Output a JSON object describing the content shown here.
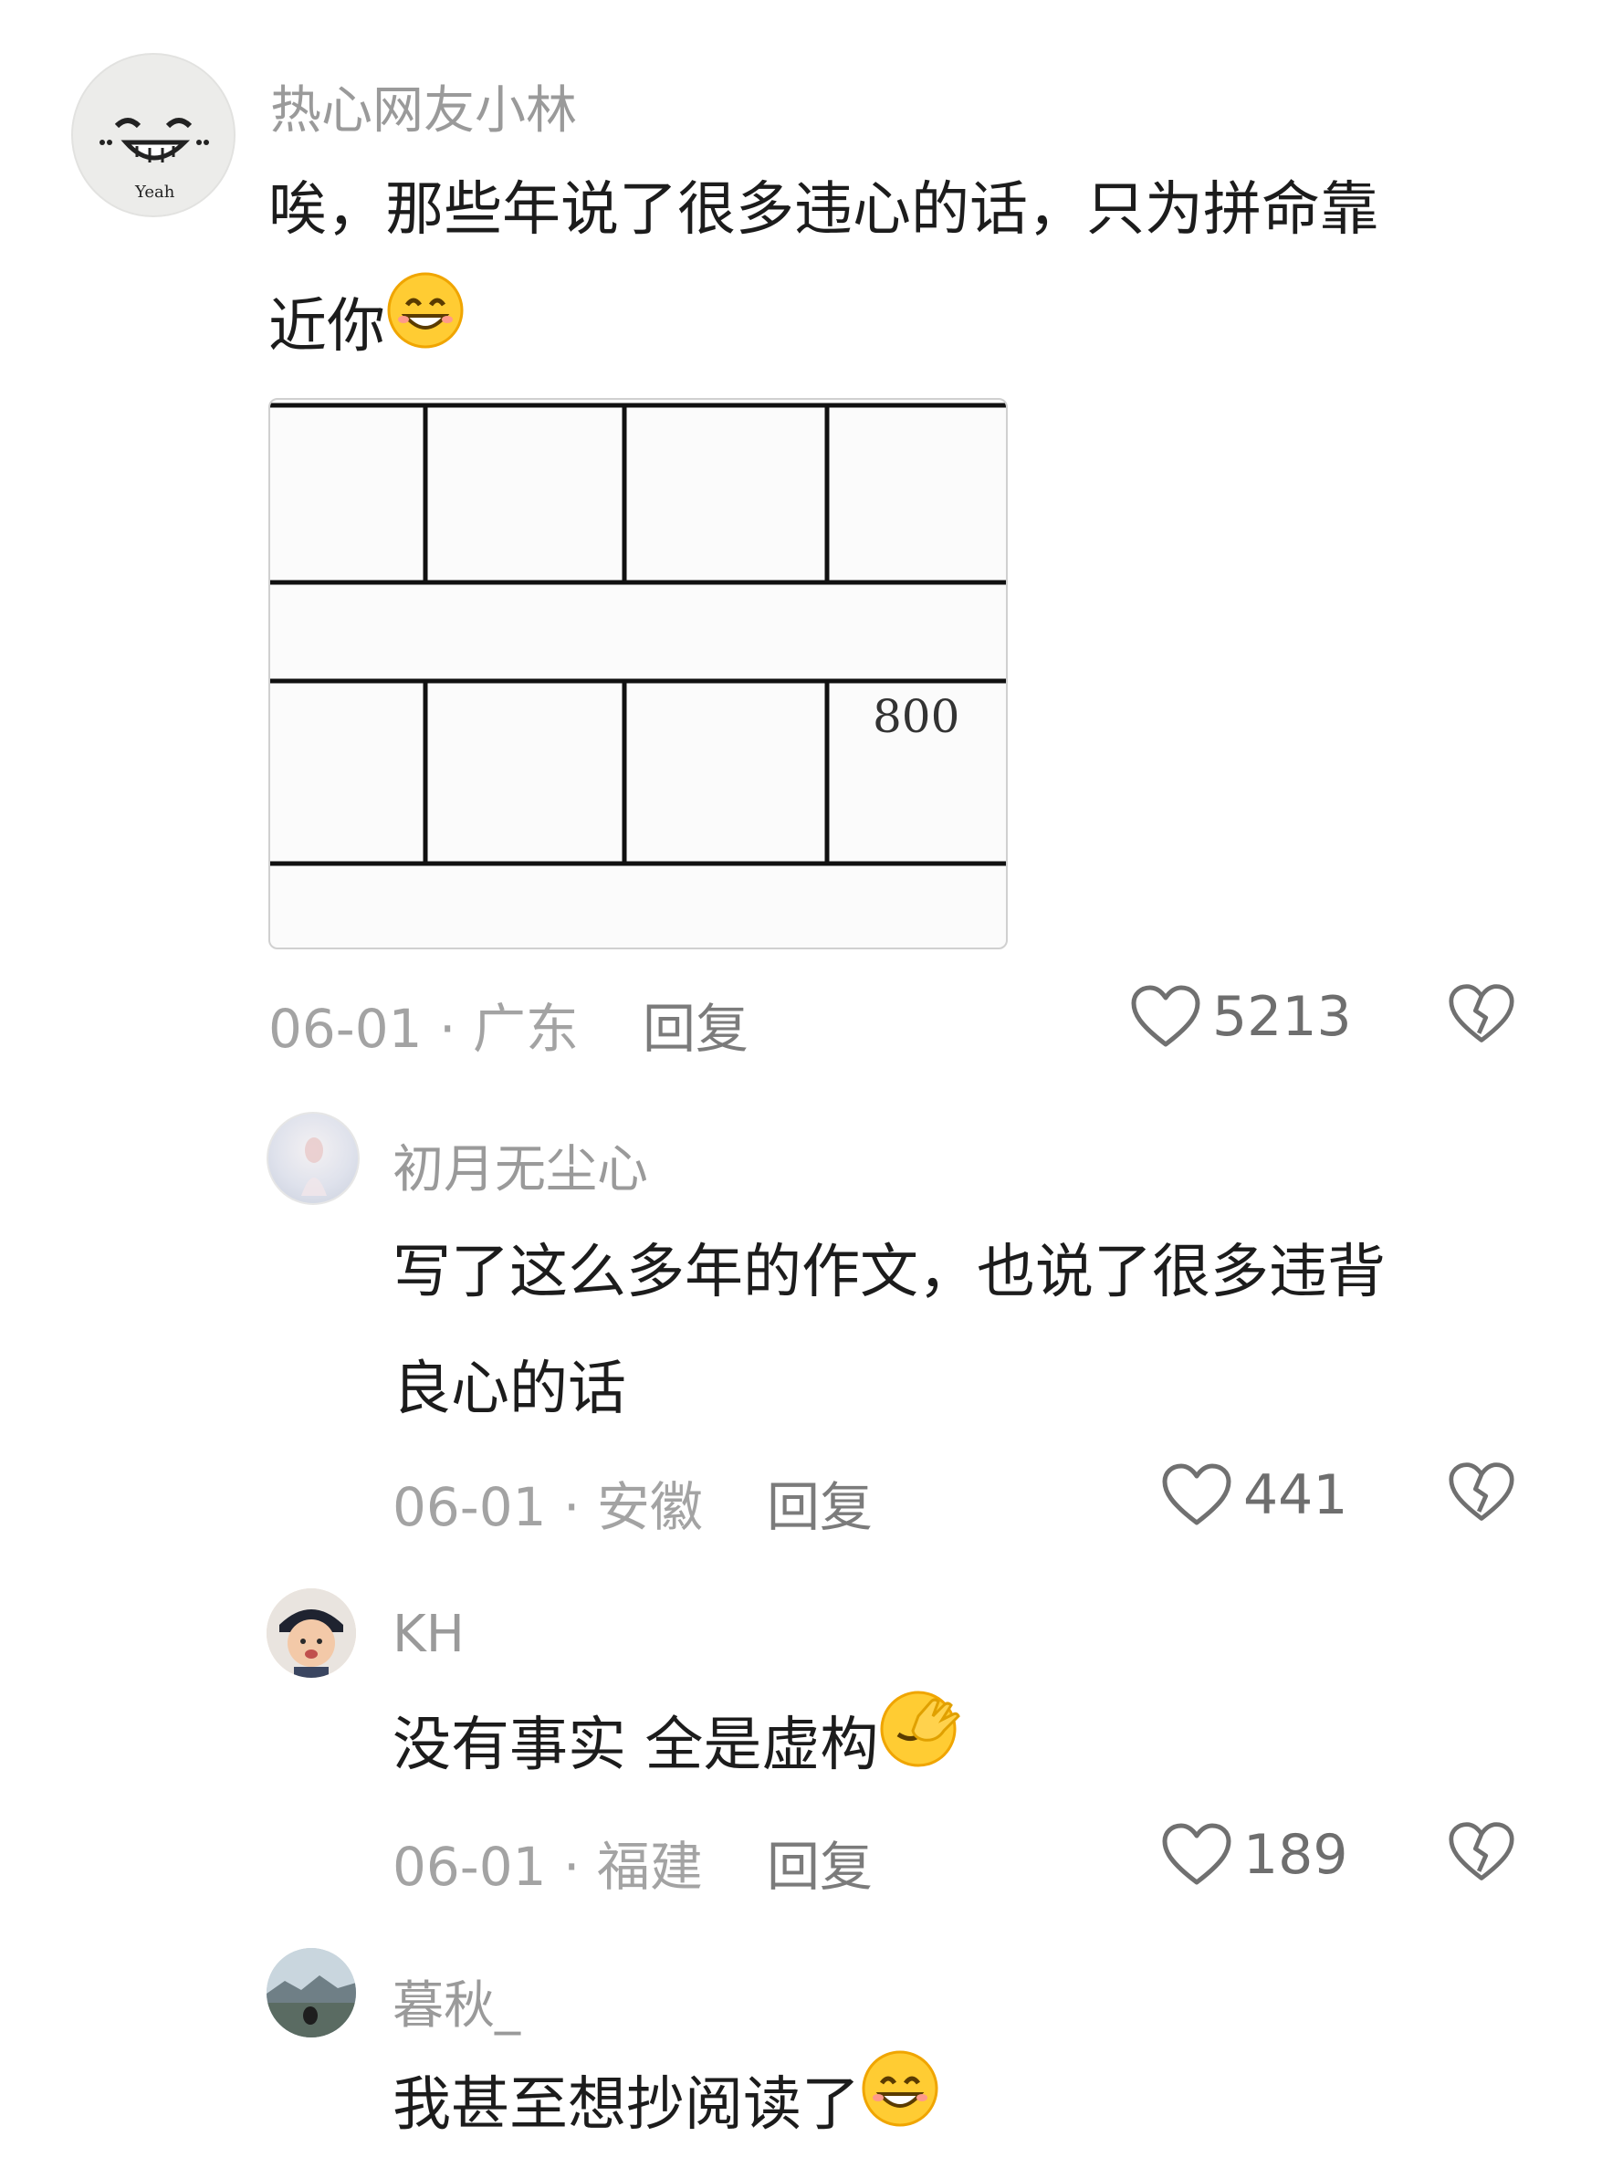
{
  "comments": [
    {
      "user": "热心网友小林",
      "avatar_text": "Yeah",
      "text": "唉，那些年说了很多违心的话，只为拼命靠近你",
      "text_line1": "唉，那些年说了很多违心的话，只为拼命靠",
      "text_line2": "近你",
      "emoji": "grinning-face",
      "image": {
        "grid_text": "800"
      },
      "date": "06-01",
      "region": "广东",
      "reply_label": "回复",
      "likes": "5213"
    },
    {
      "user": "初月无尘心",
      "text_line1": "写了这么多年的作文，也说了很多违背",
      "text_line2": "良心的话",
      "date": "06-01",
      "region": "安徽",
      "reply_label": "回复",
      "likes": "441"
    },
    {
      "user": "KH",
      "text_line1": "没有事实 全是虚构",
      "emoji": "face-with-hand-over-eyes",
      "date": "06-01",
      "region": "福建",
      "reply_label": "回复",
      "likes": "189"
    },
    {
      "user": "暮秋_",
      "text_line1": "我甚至想抄阅读了",
      "emoji": "grinning-face"
    }
  ],
  "meta_separator": " · ",
  "colors": {
    "text": "#1c1c1c",
    "muted": "#a3a3a3",
    "reply": "#7b7b7b",
    "icon": "#707070"
  }
}
